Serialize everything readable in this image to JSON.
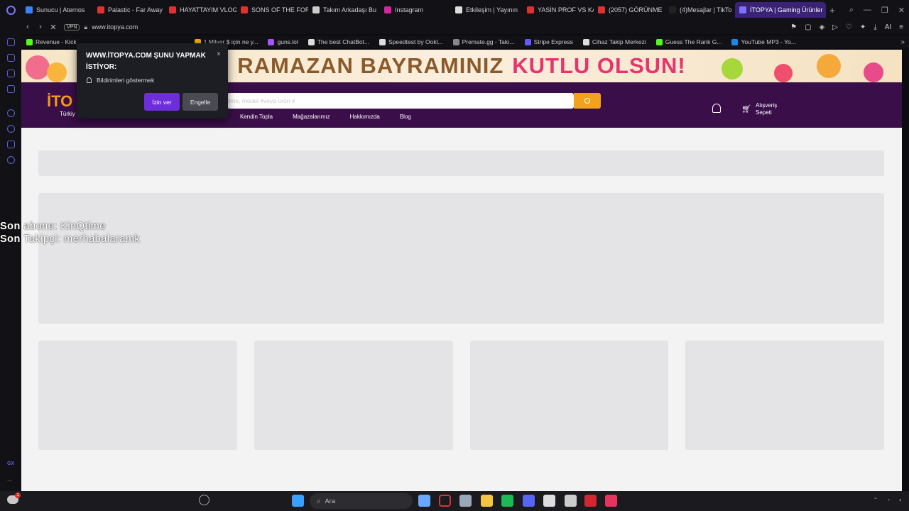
{
  "browser": {
    "tabs": [
      {
        "label": "Sunucu | Aternos",
        "color": "#3b82f6"
      },
      {
        "label": "Palastic - Far Away",
        "color": "#e03030"
      },
      {
        "label": "HAYATTAYIM VLOG",
        "color": "#e03030"
      },
      {
        "label": "SONS OF THE FOR",
        "color": "#e03030"
      },
      {
        "label": "Takım Arkadaşı Bu",
        "color": "#cccccc"
      },
      {
        "label": "Instagram",
        "color": "#d6249f"
      },
      {
        "label": "Etkileşim | Yayının",
        "color": "#dddddd"
      },
      {
        "label": "YASİN PROF VS KA",
        "color": "#e03030"
      },
      {
        "label": "(2057) GÖRÜNME",
        "color": "#e03030"
      },
      {
        "label": "(4)Mesajlar | TikTo",
        "color": "#222222"
      },
      {
        "label": "İTOPYA | Gaming Ürünler",
        "color": "#7a73ff",
        "active": true
      }
    ],
    "vpn_label": "VPN",
    "url": "www.itopya.com",
    "ai_label": "AI",
    "bookmarks": [
      {
        "label": "Revenue - Kick",
        "color": "#53fc18"
      },
      {
        "label": "1 Milyar $ için ne y...",
        "color": "#f5b400"
      },
      {
        "label": "guns.lol",
        "color": "#a855f7"
      },
      {
        "label": "The best ChatBot...",
        "color": "#dddddd"
      },
      {
        "label": "Speedtest by Ookl...",
        "color": "#dddddd"
      },
      {
        "label": "Premate.gg - Takı...",
        "color": "#888888"
      },
      {
        "label": "Stripe Express",
        "color": "#635bff"
      },
      {
        "label": "Cihaz Takip Merkezi",
        "color": "#dddddd"
      },
      {
        "label": "Guess The Rank G...",
        "color": "#53fc18"
      },
      {
        "label": "YouTube MP3 - Yo...",
        "color": "#1e88e5"
      }
    ]
  },
  "sidebar": {
    "gx_label": "GX",
    "more_label": "..."
  },
  "site": {
    "banner": {
      "part1": "RAMAZAN BAYRAMINIZ",
      "part2": "KUTLU OLSUN!"
    },
    "logo": "İTO",
    "logo_sub": "Türkiy",
    "search_placeholder": "time, model #veya ürün #",
    "menu": [
      "Kendin Topla",
      "Mağazalarımız",
      "Hakkımızda",
      "Blog"
    ],
    "cart_label_1": "Alışveriş",
    "cart_label_2": "Sepeti"
  },
  "popup": {
    "title": "WWW.İTOPYA.COM ŞUNU YAPMAK İSTİYOR:",
    "permission": "Bildirimleri göstermek",
    "allow": "İzin ver",
    "block": "Engelle",
    "close": "×"
  },
  "overlay": {
    "line1_prefix": "Son",
    "line1_rest": " abone: KinQtime",
    "line2_prefix": "Son",
    "line2_rest": " Takipçi: merhabalaramk"
  },
  "taskbar": {
    "search_label": "Ara",
    "badge": "1",
    "apps": [
      {
        "name": "windows-start",
        "color": "#3aa0ff"
      },
      {
        "name": "drop",
        "color": "#6aa8ff"
      },
      {
        "name": "opera",
        "color": "#d9343a"
      },
      {
        "name": "steam",
        "color": "#9aa7b7"
      },
      {
        "name": "folder",
        "color": "#f4c542"
      },
      {
        "name": "spotify",
        "color": "#1db954"
      },
      {
        "name": "discord",
        "color": "#5865f2"
      },
      {
        "name": "obs",
        "color": "#dddddd"
      },
      {
        "name": "settings",
        "color": "#cccccc"
      },
      {
        "name": "red-app",
        "color": "#d22630"
      },
      {
        "name": "dollar-app",
        "color": "#e8335e"
      }
    ]
  }
}
